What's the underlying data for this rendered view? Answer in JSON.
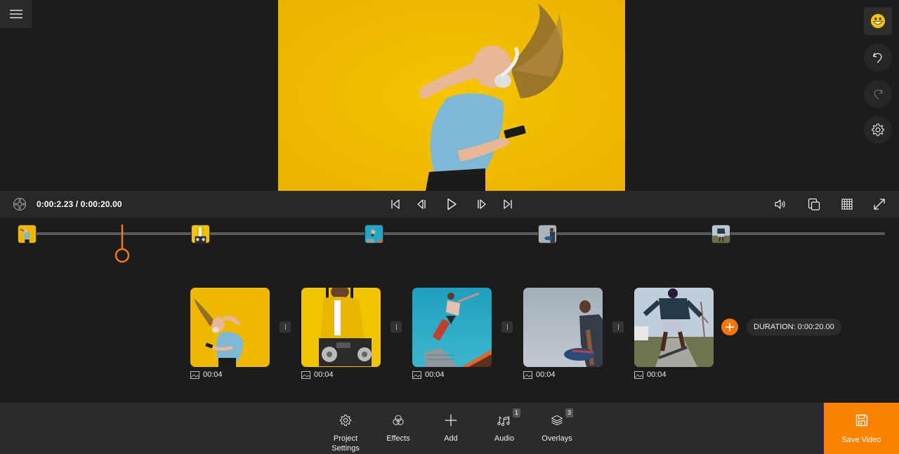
{
  "app": {
    "menu_icon": "hamburger-menu-icon"
  },
  "preview": {
    "description": "Woman with headphones dancing against yellow background"
  },
  "side_actions": [
    {
      "name": "feedback",
      "icon": "smiley-icon"
    },
    {
      "name": "undo",
      "icon": "undo-icon"
    },
    {
      "name": "redo",
      "icon": "redo-icon",
      "disabled": true
    },
    {
      "name": "settings",
      "icon": "gear-icon"
    }
  ],
  "controls": {
    "current_time": "0:00:2.23",
    "total_time": "0:00:20.00",
    "timecode": "0:00:2.23 / 0:00:20.00",
    "transport": [
      "skip-to-start",
      "previous-frame",
      "play",
      "next-frame",
      "skip-to-end"
    ],
    "right_icons": [
      "volume",
      "aspect-ratio",
      "grid",
      "fullscreen"
    ]
  },
  "scrubber": {
    "playhead_position": 0.1115,
    "markers": [
      "clip-1",
      "clip-2",
      "clip-3",
      "clip-4",
      "clip-5"
    ]
  },
  "clips": [
    {
      "id": "clip-1",
      "duration": "00:04",
      "type": "image",
      "subject": "woman dancing with headphones"
    },
    {
      "id": "clip-2",
      "duration": "00:04",
      "type": "image",
      "subject": "man in yellow jacket with DJ controller"
    },
    {
      "id": "clip-3",
      "duration": "00:04",
      "type": "image",
      "subject": "skateboarder jumping"
    },
    {
      "id": "clip-4",
      "duration": "00:04",
      "type": "image",
      "subject": "man holding skateboard"
    },
    {
      "id": "clip-5",
      "duration": "00:04",
      "type": "image",
      "subject": "man skateboarding on sidewalk"
    }
  ],
  "storyboard": {
    "duration_label": "DURATION: 0:00:20.00"
  },
  "toolbar": {
    "project_settings": "Project Settings",
    "project_settings_line1": "Project",
    "project_settings_line2": "Settings",
    "effects": "Effects",
    "add": "Add",
    "audio": "Audio",
    "audio_count": "1",
    "overlays": "Overlays",
    "overlays_count": "3",
    "save_video": "Save Video"
  },
  "colors": {
    "accent": "#f98400",
    "background": "#1c1c1c",
    "toolbar": "#2b2b2b"
  }
}
